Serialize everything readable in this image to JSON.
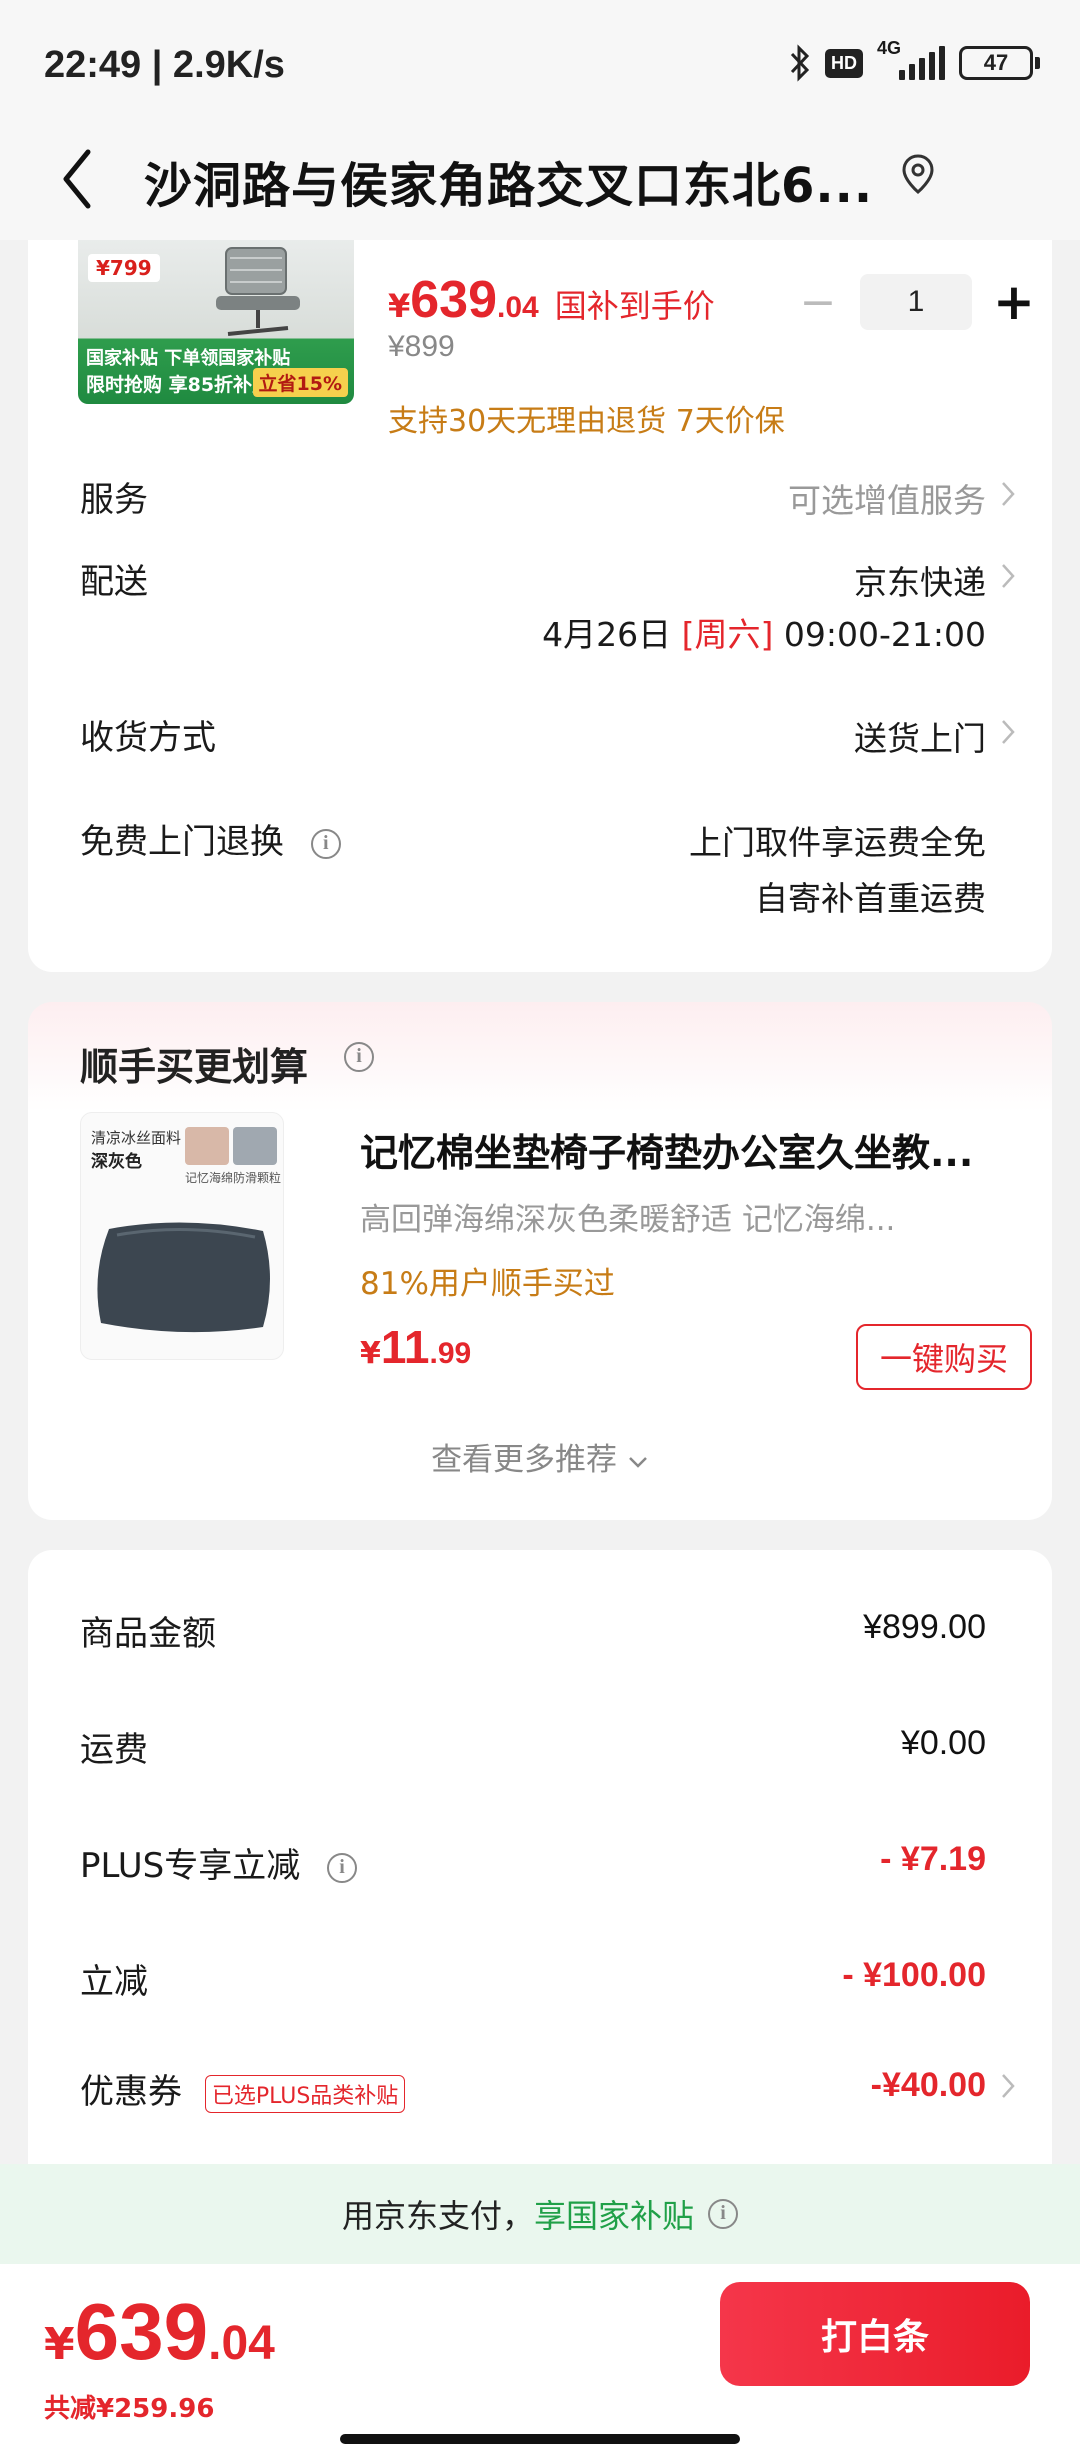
{
  "status_bar": {
    "time": "22:49 | 2.9K/s",
    "hd": "HD",
    "network": "4G",
    "battery": "47"
  },
  "header": {
    "title": "沙洞路与侯家角路交叉口东北6..."
  },
  "product": {
    "badge": "¥799",
    "img_line1": "国家补贴 下单领国家补贴",
    "img_line2": "限时抢购 享85折补贴",
    "img_discount": "立省15%",
    "currency": "¥",
    "price_main": "639",
    "price_decimal": ".04",
    "price_tag": "国补到手价",
    "original_price": "¥899",
    "quantity": "1",
    "promise": "支持30天无理由退货  7天价保"
  },
  "rows": {
    "service": {
      "label": "服务",
      "value": "可选增值服务"
    },
    "delivery": {
      "label": "配送",
      "value": "京东快递",
      "date": "4月26日",
      "weekday": "[周六]",
      "time": "09:00-21:00"
    },
    "receive": {
      "label": "收货方式",
      "value": "送货上门"
    },
    "free_return": {
      "label": "免费上门退换",
      "value1": "上门取件享运费全免",
      "value2": "自寄补首重运费"
    }
  },
  "recommend": {
    "title": "顺手买更划算",
    "thumb_line1": "清凉冰丝面料",
    "thumb_line2": "深灰色",
    "thumb_cap1": "记忆海绵",
    "thumb_cap2": "防滑颗粒",
    "name": "记忆棉坐垫椅子椅垫办公室久坐教...",
    "desc": "高回弹海绵深灰色柔暖舒适   记忆海绵...",
    "bought": "81%用户顺手买过",
    "currency": "¥",
    "price_main": "11",
    "price_decimal": ".99",
    "buy_label": "一键购买",
    "more_label": "查看更多推荐"
  },
  "summary": {
    "goods": {
      "label": "商品金额",
      "value": "¥899.00"
    },
    "shipping": {
      "label": "运费",
      "value": "¥0.00"
    },
    "plus": {
      "label": "PLUS专享立减",
      "value": "- ¥7.19"
    },
    "instant": {
      "label": "立减",
      "value": "- ¥100.00"
    },
    "coupon": {
      "label": "优惠券",
      "tag": "已选PLUS品类补贴",
      "value": "-¥40.00"
    }
  },
  "pay_banner": {
    "text1": "用京东支付，",
    "text2": "享国家补贴"
  },
  "bottom": {
    "currency": "¥",
    "total_main": "639",
    "total_decimal": ".04",
    "saved": "共减¥259.96",
    "pay_label": "打白条"
  },
  "colors": {
    "accent": "#e4262c",
    "promise": "#c77c16",
    "green": "#20a048"
  }
}
